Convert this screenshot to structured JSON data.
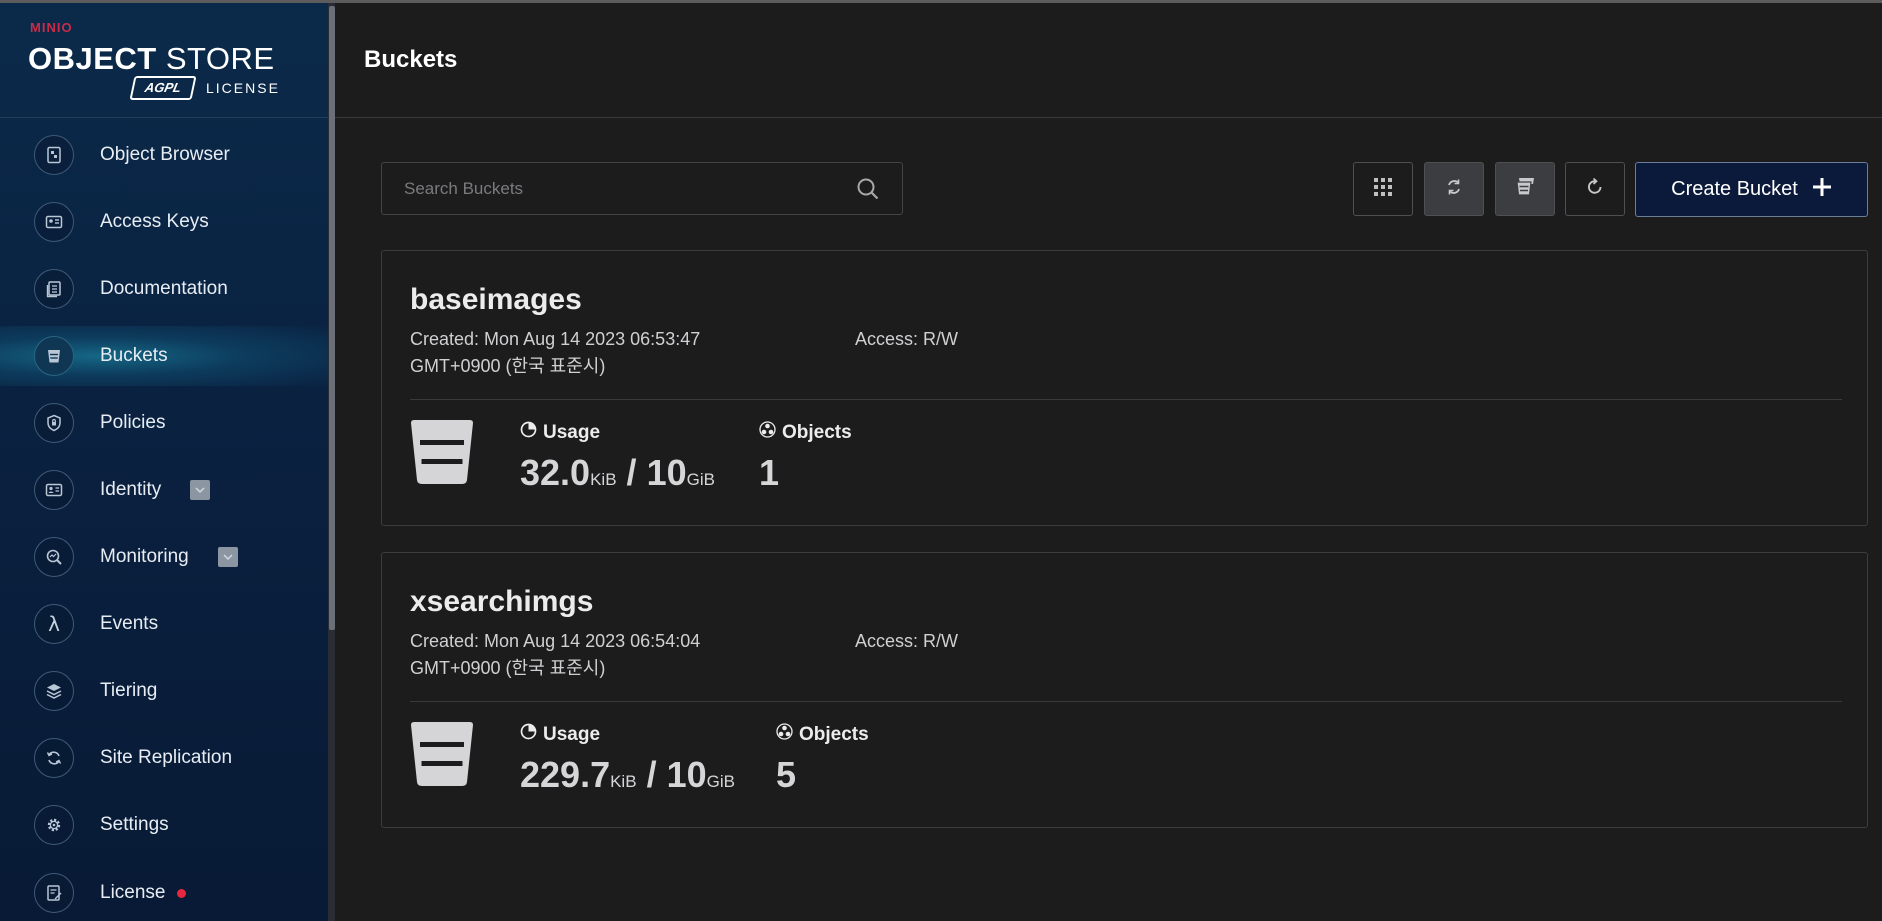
{
  "sidebar": {
    "logo": {
      "brand": "MINIO",
      "title_bold": "OBJECT",
      "title_light": " STORE",
      "badge": "AGPL",
      "license": "LICENSE"
    },
    "items": [
      {
        "label": "Object Browser",
        "icon": "object-browser-icon"
      },
      {
        "label": "Access Keys",
        "icon": "access-keys-icon"
      },
      {
        "label": "Documentation",
        "icon": "documentation-icon"
      },
      {
        "label": "Buckets",
        "icon": "buckets-icon",
        "active": true
      },
      {
        "label": "Policies",
        "icon": "policies-icon"
      },
      {
        "label": "Identity",
        "icon": "identity-icon",
        "expandable": true
      },
      {
        "label": "Monitoring",
        "icon": "monitoring-icon",
        "expandable": true
      },
      {
        "label": "Events",
        "icon": "lambda-icon"
      },
      {
        "label": "Tiering",
        "icon": "tiering-icon"
      },
      {
        "label": "Site Replication",
        "icon": "site-replication-icon"
      },
      {
        "label": "Settings",
        "icon": "gear-icon"
      },
      {
        "label": "License",
        "icon": "license-icon",
        "alert_dot": true
      }
    ]
  },
  "header": {
    "title": "Buckets"
  },
  "toolbar": {
    "search_placeholder": "Search Buckets",
    "create_bucket_label": "Create Bucket"
  },
  "buckets": [
    {
      "name": "baseimages",
      "created": "Created: Mon Aug 14 2023 06:53:47 GMT+0900 (한국 표준시)",
      "access": "Access: R/W",
      "usage_label": "Usage",
      "usage_value": "32.0",
      "usage_unit": "KiB",
      "quota_sep": " / ",
      "quota_value": "10",
      "quota_unit": "GiB",
      "objects_label": "Objects",
      "objects_value": "1"
    },
    {
      "name": "xsearchimgs",
      "created": "Created: Mon Aug 14 2023 06:54:04 GMT+0900 (한국 표준시)",
      "access": "Access: R/W",
      "usage_label": "Usage",
      "usage_value": "229.7",
      "usage_unit": "KiB",
      "quota_sep": " / ",
      "quota_value": "10",
      "quota_unit": "GiB",
      "objects_label": "Objects",
      "objects_value": "5"
    }
  ],
  "colors": {
    "accent_red": "#c72c48",
    "sidebar_bg": "#0a2140",
    "create_button_bg": "#0b1a3a"
  }
}
